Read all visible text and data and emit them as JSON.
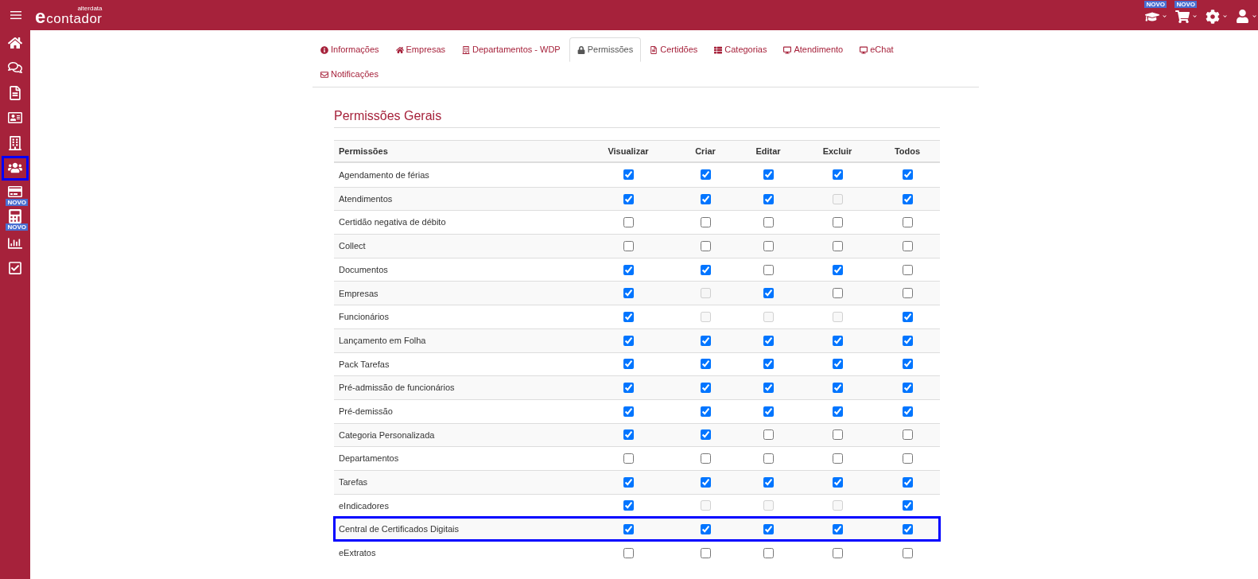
{
  "header": {
    "logo": {
      "mark": "e",
      "name": "contador",
      "tagline": "alterdata"
    },
    "actions": [
      {
        "badge": "NOVO",
        "dropdown": true
      },
      {
        "badge": "NOVO",
        "dropdown": true
      },
      {
        "dropdown": true
      },
      {
        "dropdown": true
      }
    ]
  },
  "sidebar": {
    "items": [
      {
        "highlighted": false
      },
      {
        "highlighted": false
      },
      {
        "highlighted": false
      },
      {
        "highlighted": false
      },
      {
        "highlighted": false
      },
      {
        "highlighted": true
      },
      {
        "highlighted": false,
        "badge": "NOVO"
      },
      {
        "highlighted": false,
        "badge": "NOVO"
      },
      {
        "highlighted": false
      },
      {
        "highlighted": false
      }
    ]
  },
  "tabs": [
    {
      "label": "Informações",
      "selected": false
    },
    {
      "label": "Empresas",
      "selected": false
    },
    {
      "label": "Departamentos - WDP",
      "selected": false
    },
    {
      "label": "Permissões",
      "selected": true
    },
    {
      "label": "Certidões",
      "selected": false
    },
    {
      "label": "Categorias",
      "selected": false
    },
    {
      "label": "Atendimento",
      "selected": false
    },
    {
      "label": "eChat",
      "selected": false
    },
    {
      "label": "Notificações",
      "selected": false
    }
  ],
  "section": {
    "title": "Permissões Gerais"
  },
  "table": {
    "columns": [
      "Permissões",
      "Visualizar",
      "Criar",
      "Editar",
      "Excluir",
      "Todos"
    ],
    "rows": [
      {
        "name": "Agendamento de férias",
        "highlighted": false,
        "cells": [
          {
            "checked": true,
            "disabled": false
          },
          {
            "checked": true,
            "disabled": false
          },
          {
            "checked": true,
            "disabled": false
          },
          {
            "checked": true,
            "disabled": false
          },
          {
            "checked": true,
            "disabled": false
          }
        ]
      },
      {
        "name": "Atendimentos",
        "highlighted": false,
        "cells": [
          {
            "checked": true,
            "disabled": false
          },
          {
            "checked": true,
            "disabled": false
          },
          {
            "checked": true,
            "disabled": false
          },
          {
            "checked": false,
            "disabled": true
          },
          {
            "checked": true,
            "disabled": false
          }
        ]
      },
      {
        "name": "Certidão negativa de débito",
        "highlighted": false,
        "cells": [
          {
            "checked": false,
            "disabled": false
          },
          {
            "checked": false,
            "disabled": false
          },
          {
            "checked": false,
            "disabled": false
          },
          {
            "checked": false,
            "disabled": false
          },
          {
            "checked": false,
            "disabled": false
          }
        ]
      },
      {
        "name": "Collect",
        "highlighted": false,
        "cells": [
          {
            "checked": false,
            "disabled": false
          },
          {
            "checked": false,
            "disabled": false
          },
          {
            "checked": false,
            "disabled": false
          },
          {
            "checked": false,
            "disabled": false
          },
          {
            "checked": false,
            "disabled": false
          }
        ]
      },
      {
        "name": "Documentos",
        "highlighted": false,
        "cells": [
          {
            "checked": true,
            "disabled": false
          },
          {
            "checked": true,
            "disabled": false
          },
          {
            "checked": false,
            "disabled": false
          },
          {
            "checked": true,
            "disabled": false
          },
          {
            "checked": false,
            "disabled": false
          }
        ]
      },
      {
        "name": "Empresas",
        "highlighted": false,
        "cells": [
          {
            "checked": true,
            "disabled": false
          },
          {
            "checked": false,
            "disabled": true
          },
          {
            "checked": true,
            "disabled": false
          },
          {
            "checked": false,
            "disabled": false
          },
          {
            "checked": false,
            "disabled": false
          }
        ]
      },
      {
        "name": "Funcionários",
        "highlighted": false,
        "cells": [
          {
            "checked": true,
            "disabled": false
          },
          {
            "checked": false,
            "disabled": true
          },
          {
            "checked": false,
            "disabled": true
          },
          {
            "checked": false,
            "disabled": true
          },
          {
            "checked": true,
            "disabled": false
          }
        ]
      },
      {
        "name": "Lançamento em Folha",
        "highlighted": false,
        "cells": [
          {
            "checked": true,
            "disabled": false
          },
          {
            "checked": true,
            "disabled": false
          },
          {
            "checked": true,
            "disabled": false
          },
          {
            "checked": true,
            "disabled": false
          },
          {
            "checked": true,
            "disabled": false
          }
        ]
      },
      {
        "name": "Pack Tarefas",
        "highlighted": false,
        "cells": [
          {
            "checked": true,
            "disabled": false
          },
          {
            "checked": true,
            "disabled": false
          },
          {
            "checked": true,
            "disabled": false
          },
          {
            "checked": true,
            "disabled": false
          },
          {
            "checked": true,
            "disabled": false
          }
        ]
      },
      {
        "name": "Pré-admissão de funcionários",
        "highlighted": false,
        "cells": [
          {
            "checked": true,
            "disabled": false
          },
          {
            "checked": true,
            "disabled": false
          },
          {
            "checked": true,
            "disabled": false
          },
          {
            "checked": true,
            "disabled": false
          },
          {
            "checked": true,
            "disabled": false
          }
        ]
      },
      {
        "name": "Pré-demissão",
        "highlighted": false,
        "cells": [
          {
            "checked": true,
            "disabled": false
          },
          {
            "checked": true,
            "disabled": false
          },
          {
            "checked": true,
            "disabled": false
          },
          {
            "checked": true,
            "disabled": false
          },
          {
            "checked": true,
            "disabled": false
          }
        ]
      },
      {
        "name": "Categoria Personalizada",
        "highlighted": false,
        "cells": [
          {
            "checked": true,
            "disabled": false
          },
          {
            "checked": true,
            "disabled": false
          },
          {
            "checked": false,
            "disabled": false
          },
          {
            "checked": false,
            "disabled": false
          },
          {
            "checked": false,
            "disabled": false
          }
        ]
      },
      {
        "name": "Departamentos",
        "highlighted": false,
        "cells": [
          {
            "checked": false,
            "disabled": false
          },
          {
            "checked": false,
            "disabled": false
          },
          {
            "checked": false,
            "disabled": false
          },
          {
            "checked": false,
            "disabled": false
          },
          {
            "checked": false,
            "disabled": false
          }
        ]
      },
      {
        "name": "Tarefas",
        "highlighted": false,
        "cells": [
          {
            "checked": true,
            "disabled": false
          },
          {
            "checked": true,
            "disabled": false
          },
          {
            "checked": true,
            "disabled": false
          },
          {
            "checked": true,
            "disabled": false
          },
          {
            "checked": true,
            "disabled": false
          }
        ]
      },
      {
        "name": "eIndicadores",
        "highlighted": false,
        "cells": [
          {
            "checked": true,
            "disabled": false
          },
          {
            "checked": false,
            "disabled": true
          },
          {
            "checked": false,
            "disabled": true
          },
          {
            "checked": false,
            "disabled": true
          },
          {
            "checked": true,
            "disabled": false
          }
        ]
      },
      {
        "name": "Central de Certificados Digitais",
        "highlighted": true,
        "cells": [
          {
            "checked": true,
            "disabled": false
          },
          {
            "checked": true,
            "disabled": false
          },
          {
            "checked": true,
            "disabled": false
          },
          {
            "checked": true,
            "disabled": false
          },
          {
            "checked": true,
            "disabled": false
          }
        ]
      },
      {
        "name": "eExtratos",
        "highlighted": false,
        "cells": [
          {
            "checked": false,
            "disabled": false
          },
          {
            "checked": false,
            "disabled": false
          },
          {
            "checked": false,
            "disabled": false
          },
          {
            "checked": false,
            "disabled": false
          },
          {
            "checked": false,
            "disabled": false
          }
        ]
      }
    ]
  }
}
